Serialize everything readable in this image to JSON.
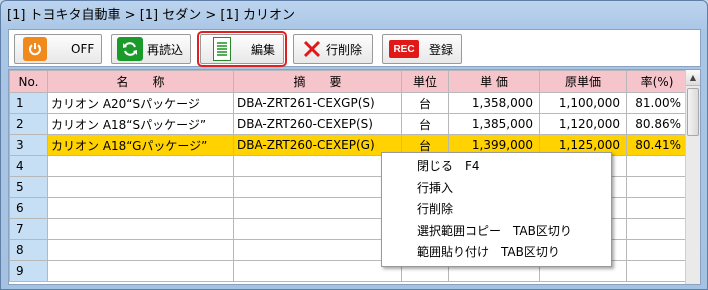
{
  "window": {
    "title": "[1] トヨキタ自動車 > [1] セダン > [1] カリオン"
  },
  "toolbar": {
    "off_label": "OFF",
    "reload_label": "再読込",
    "edit_label": "編集",
    "delete_row_label": "行削除",
    "rec_icon_text": "REC",
    "register_label": "登録"
  },
  "grid": {
    "headers": [
      "No.",
      "名　　称",
      "摘　　要",
      "単位",
      "単 価",
      "原単価",
      "率(%)"
    ],
    "rows": [
      {
        "no": "1",
        "name": "カリオン A20“Sパッケージ",
        "spec": "DBA-ZRT261-CEXGP(S)",
        "unit": "台",
        "price": "1,358,000",
        "cost": "1,100,000",
        "rate": "81.00%"
      },
      {
        "no": "2",
        "name": "カリオン A18“Sパッケージ”",
        "spec": "DBA-ZRT260-CEXEP(S)",
        "unit": "台",
        "price": "1,385,000",
        "cost": "1,120,000",
        "rate": "80.86%"
      },
      {
        "no": "3",
        "name": "カリオン A18“Gパッケージ”",
        "spec": "DBA-ZRT260-CEXEP(G)",
        "unit": "台",
        "price": "1,399,000",
        "cost": "1,125,000",
        "rate": "80.41%"
      },
      {
        "no": "4",
        "name": "",
        "spec": "",
        "unit": "",
        "price": "",
        "cost": "",
        "rate": ""
      },
      {
        "no": "5",
        "name": "",
        "spec": "",
        "unit": "",
        "price": "",
        "cost": "",
        "rate": ""
      },
      {
        "no": "6",
        "name": "",
        "spec": "",
        "unit": "",
        "price": "",
        "cost": "",
        "rate": ""
      },
      {
        "no": "7",
        "name": "",
        "spec": "",
        "unit": "",
        "price": "",
        "cost": "",
        "rate": ""
      },
      {
        "no": "8",
        "name": "",
        "spec": "",
        "unit": "",
        "price": "",
        "cost": "",
        "rate": ""
      },
      {
        "no": "9",
        "name": "",
        "spec": "",
        "unit": "",
        "price": "",
        "cost": "",
        "rate": ""
      }
    ],
    "highlight_color": "#ffd200",
    "header_color": "#f5c5cb",
    "row_number_color": "#c6dff5"
  },
  "context_menu": {
    "items": [
      "閉じる　F4",
      "行挿入",
      "行削除",
      "選択範囲コピー　TAB区切り",
      "範囲貼り付け　TAB区切り"
    ]
  }
}
